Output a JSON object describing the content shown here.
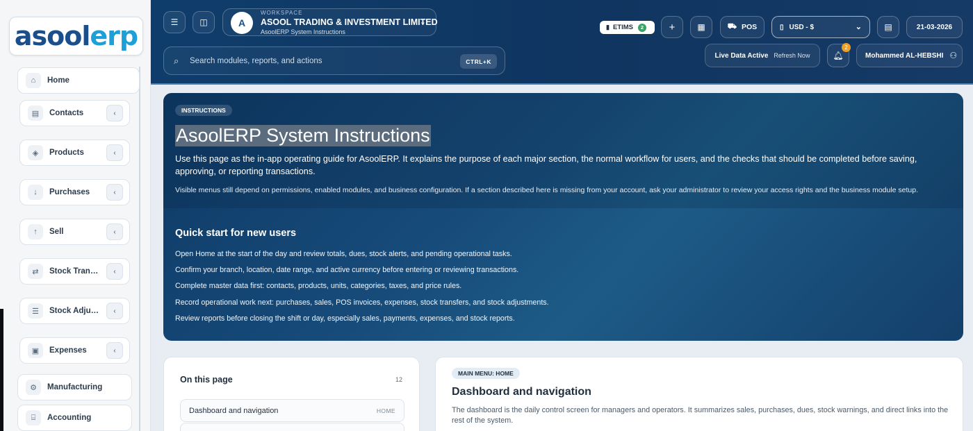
{
  "sidebar": {
    "logo_part1": "asool",
    "logo_part2": "erp",
    "items": [
      {
        "label": "Home",
        "icon": "home-icon"
      },
      {
        "label": "Contacts",
        "icon": "contacts-icon"
      },
      {
        "label": "Products",
        "icon": "products-icon"
      },
      {
        "label": "Purchases",
        "icon": "purchases-icon"
      },
      {
        "label": "Sell",
        "icon": "sell-icon"
      },
      {
        "label": "Stock Transfers",
        "icon": "transfer-icon"
      },
      {
        "label": "Stock Adjustment",
        "icon": "adjustment-icon"
      },
      {
        "label": "Expenses",
        "icon": "expenses-icon"
      },
      {
        "label": "Manufacturing",
        "icon": "manufacturing-icon"
      },
      {
        "label": "Accounting",
        "icon": "accounting-icon"
      }
    ]
  },
  "header": {
    "workspace_caption": "WORKSPACE",
    "workspace_name": "ASOOL TRADING & INVESTMENT LIMITED",
    "workspace_sub": "AsoolERP System Instructions",
    "search_placeholder": "Search modules, reports, and actions",
    "shortcut": "CTRL+K",
    "etims_label": "ETIMS",
    "etims_count": "2",
    "pos_label": "POS",
    "currency": "USD - $",
    "date": "21-03-2026",
    "live_status": "Live Data Active",
    "refresh": "Refresh Now",
    "notif_count": "2",
    "user_name": "Mohammed AL-HEBSHI"
  },
  "hero": {
    "pill": "INSTRUCTIONS",
    "title": "AsoolERP System Instructions",
    "p1": "Use this page as the in-app operating guide for AsoolERP. It explains the purpose of each major section, the normal workflow for users, and the checks that should be completed before saving, approving, or reporting transactions.",
    "p2": "Visible menus still depend on permissions, enabled modules, and business configuration. If a section described here is missing from your account, ask your administrator to review your access rights and the business module setup.",
    "quick_title": "Quick start for new users",
    "quick_items": [
      "Open Home at the start of the day and review totals, dues, stock alerts, and pending operational tasks.",
      "Confirm your branch, location, date range, and active currency before entering or reviewing transactions.",
      "Complete master data first: contacts, products, units, categories, taxes, and price rules.",
      "Record operational work next: purchases, sales, POS invoices, expenses, stock transfers, and stock adjustments.",
      "Review reports before closing the shift or day, especially sales, payments, expenses, and stock reports."
    ]
  },
  "on_this_page": {
    "title": "On this page",
    "count": "12",
    "items": [
      {
        "label": "Dashboard and navigation",
        "tag": "HOME"
      }
    ]
  },
  "main_section": {
    "pill": "MAIN MENU: HOME",
    "title": "Dashboard and navigation",
    "body": "The dashboard is the daily control screen for managers and operators. It summarizes sales, purchases, dues, stock warnings, and direct links into the rest of the system."
  }
}
